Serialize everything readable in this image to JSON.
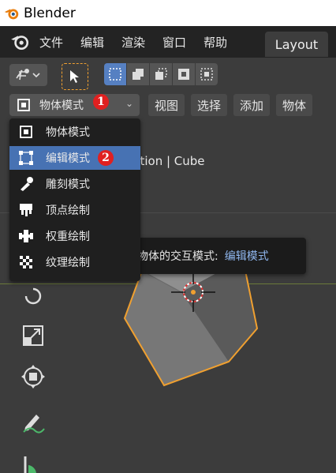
{
  "window": {
    "title": "Blender",
    "logo_icon": "blender-logo-icon"
  },
  "menubar": {
    "items": [
      "文件",
      "编辑",
      "渲染",
      "窗口",
      "帮助"
    ],
    "workspace_tab": "Layout"
  },
  "header": {
    "mode_label": "物体模式",
    "menus": [
      "视图",
      "选择",
      "添加",
      "物体"
    ]
  },
  "viewport": {
    "overlay_text": "ection | Cube",
    "accent_color": "#4772b3",
    "selection_color": "#f0a030"
  },
  "mode_dropdown": {
    "items": [
      {
        "label": "物体模式",
        "icon": "object-mode-icon"
      },
      {
        "label": "编辑模式",
        "icon": "edit-mode-icon",
        "highlighted": true
      },
      {
        "label": "雕刻模式",
        "icon": "sculpt-mode-icon"
      },
      {
        "label": "顶点绘制",
        "icon": "vertex-paint-icon"
      },
      {
        "label": "权重绘制",
        "icon": "weight-paint-icon"
      },
      {
        "label": "纹理绘制",
        "icon": "texture-paint-icon"
      }
    ]
  },
  "tooltip": {
    "label": "设置物体的交互模式:",
    "value": "编辑模式"
  },
  "badges": {
    "one": "1",
    "two": "2"
  }
}
